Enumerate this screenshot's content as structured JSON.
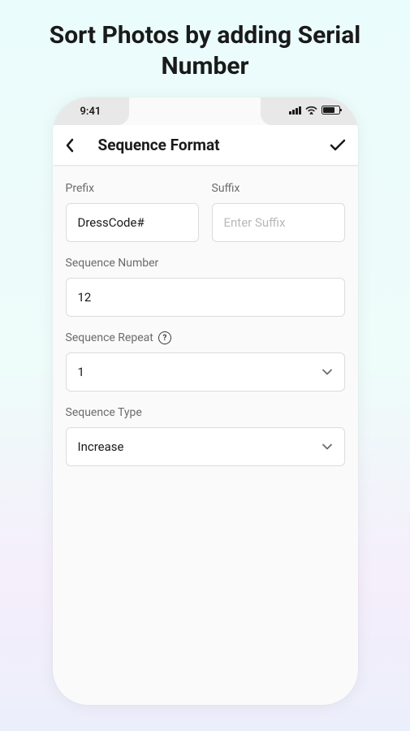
{
  "pageTitle": "Sort Photos by adding Serial Number",
  "statusBar": {
    "time": "9:41"
  },
  "header": {
    "title": "Sequence Format"
  },
  "form": {
    "prefix": {
      "label": "Prefix",
      "value": "DressCode#"
    },
    "suffix": {
      "label": "Suffix",
      "placeholder": "Enter Suffix",
      "value": ""
    },
    "sequenceNumber": {
      "label": "Sequence Number",
      "value": "12"
    },
    "sequenceRepeat": {
      "label": "Sequence Repeat",
      "value": "1"
    },
    "sequenceType": {
      "label": "Sequence Type",
      "value": "Increase"
    }
  }
}
